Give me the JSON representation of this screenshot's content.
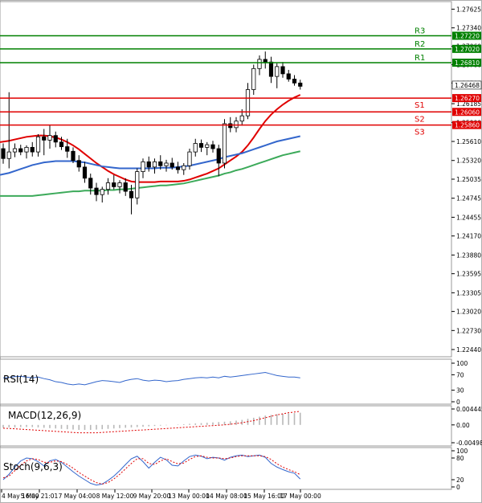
{
  "chart_data": {
    "type": "candlestick",
    "title": "",
    "x_labels": [
      "4 May 16:00",
      "5 May 21:01",
      "7 May 04:00",
      "8 May 12:00",
      "9 May 20:00",
      "13 May 00:00",
      "14 May 08:00",
      "15 May 16:00",
      "17 May 00:00"
    ],
    "price_axis": {
      "ylim": [
        1.2233,
        1.2774
      ],
      "ticks": [
        "1.27625",
        "1.27340",
        "1.27060",
        "1.26780",
        "1.26500",
        "1.26185",
        "1.25900",
        "1.25610",
        "1.25320",
        "1.25035",
        "1.24745",
        "1.24455",
        "1.24170",
        "1.23880",
        "1.23595",
        "1.23305",
        "1.23020",
        "1.22730",
        "1.22440"
      ]
    },
    "current_price": "1.26468",
    "levels": [
      {
        "name": "R3",
        "value": 1.2722,
        "label": "1.27220",
        "color": "#008000"
      },
      {
        "name": "R2",
        "value": 1.2702,
        "label": "1.27020",
        "color": "#008000"
      },
      {
        "name": "R1",
        "value": 1.2681,
        "label": "1.26810",
        "color": "#008000"
      },
      {
        "name": "S1",
        "value": 1.2627,
        "label": "1.26270",
        "color": "#e00000"
      },
      {
        "name": "S2",
        "value": 1.2606,
        "label": "1.26060",
        "color": "#e00000"
      },
      {
        "name": "S3",
        "value": 1.2586,
        "label": "1.25860",
        "color": "#e00000"
      }
    ],
    "candles": [
      {
        "o": 1.255,
        "h": 1.2558,
        "l": 1.2527,
        "c": 1.2535
      },
      {
        "o": 1.2535,
        "h": 1.2636,
        "l": 1.252,
        "c": 1.2545
      },
      {
        "o": 1.2545,
        "h": 1.2558,
        "l": 1.2537,
        "c": 1.255
      },
      {
        "o": 1.255,
        "h": 1.2556,
        "l": 1.254,
        "c": 1.2545
      },
      {
        "o": 1.2545,
        "h": 1.2555,
        "l": 1.2535,
        "c": 1.2552
      },
      {
        "o": 1.2552,
        "h": 1.256,
        "l": 1.2538,
        "c": 1.2545
      },
      {
        "o": 1.2545,
        "h": 1.2572,
        "l": 1.2538,
        "c": 1.2568
      },
      {
        "o": 1.2568,
        "h": 1.258,
        "l": 1.254,
        "c": 1.2563
      },
      {
        "o": 1.2563,
        "h": 1.2586,
        "l": 1.255,
        "c": 1.257
      },
      {
        "o": 1.257,
        "h": 1.2576,
        "l": 1.2552,
        "c": 1.256
      },
      {
        "o": 1.256,
        "h": 1.2568,
        "l": 1.2548,
        "c": 1.2553
      },
      {
        "o": 1.2553,
        "h": 1.2565,
        "l": 1.2536,
        "c": 1.2546
      },
      {
        "o": 1.2546,
        "h": 1.2552,
        "l": 1.2528,
        "c": 1.2532
      },
      {
        "o": 1.2532,
        "h": 1.254,
        "l": 1.2515,
        "c": 1.2522
      },
      {
        "o": 1.2522,
        "h": 1.253,
        "l": 1.2498,
        "c": 1.2505
      },
      {
        "o": 1.2505,
        "h": 1.2512,
        "l": 1.248,
        "c": 1.249
      },
      {
        "o": 1.249,
        "h": 1.2498,
        "l": 1.247,
        "c": 1.248
      },
      {
        "o": 1.248,
        "h": 1.2492,
        "l": 1.2468,
        "c": 1.2488
      },
      {
        "o": 1.2488,
        "h": 1.2505,
        "l": 1.248,
        "c": 1.2498
      },
      {
        "o": 1.2498,
        "h": 1.251,
        "l": 1.2488,
        "c": 1.2492
      },
      {
        "o": 1.2492,
        "h": 1.2502,
        "l": 1.2482,
        "c": 1.2498
      },
      {
        "o": 1.2498,
        "h": 1.2505,
        "l": 1.2478,
        "c": 1.2485
      },
      {
        "o": 1.2485,
        "h": 1.2495,
        "l": 1.245,
        "c": 1.2475
      },
      {
        "o": 1.2475,
        "h": 1.252,
        "l": 1.2465,
        "c": 1.2515
      },
      {
        "o": 1.2515,
        "h": 1.2535,
        "l": 1.2505,
        "c": 1.253
      },
      {
        "o": 1.253,
        "h": 1.2538,
        "l": 1.2515,
        "c": 1.2522
      },
      {
        "o": 1.2522,
        "h": 1.2535,
        "l": 1.2512,
        "c": 1.253
      },
      {
        "o": 1.253,
        "h": 1.254,
        "l": 1.2518,
        "c": 1.2524
      },
      {
        "o": 1.2524,
        "h": 1.2533,
        "l": 1.2515,
        "c": 1.2528
      },
      {
        "o": 1.2528,
        "h": 1.2536,
        "l": 1.2518,
        "c": 1.2522
      },
      {
        "o": 1.2522,
        "h": 1.253,
        "l": 1.2512,
        "c": 1.2518
      },
      {
        "o": 1.2518,
        "h": 1.2528,
        "l": 1.251,
        "c": 1.2524
      },
      {
        "o": 1.2524,
        "h": 1.255,
        "l": 1.2518,
        "c": 1.2545
      },
      {
        "o": 1.2545,
        "h": 1.2565,
        "l": 1.2538,
        "c": 1.2558
      },
      {
        "o": 1.2558,
        "h": 1.2564,
        "l": 1.2545,
        "c": 1.2552
      },
      {
        "o": 1.2552,
        "h": 1.256,
        "l": 1.254,
        "c": 1.2556
      },
      {
        "o": 1.2556,
        "h": 1.2562,
        "l": 1.2544,
        "c": 1.255
      },
      {
        "o": 1.255,
        "h": 1.2556,
        "l": 1.2508,
        "c": 1.2528
      },
      {
        "o": 1.2528,
        "h": 1.2595,
        "l": 1.252,
        "c": 1.2588
      },
      {
        "o": 1.2588,
        "h": 1.2598,
        "l": 1.2575,
        "c": 1.2582
      },
      {
        "o": 1.2582,
        "h": 1.2598,
        "l": 1.2575,
        "c": 1.2592
      },
      {
        "o": 1.2592,
        "h": 1.261,
        "l": 1.2585,
        "c": 1.26
      },
      {
        "o": 1.26,
        "h": 1.265,
        "l": 1.2595,
        "c": 1.264
      },
      {
        "o": 1.264,
        "h": 1.2678,
        "l": 1.2632,
        "c": 1.2672
      },
      {
        "o": 1.2672,
        "h": 1.2692,
        "l": 1.2662,
        "c": 1.2686
      },
      {
        "o": 1.2686,
        "h": 1.2698,
        "l": 1.2672,
        "c": 1.2682
      },
      {
        "o": 1.2682,
        "h": 1.269,
        "l": 1.265,
        "c": 1.266
      },
      {
        "o": 1.266,
        "h": 1.268,
        "l": 1.2642,
        "c": 1.2675
      },
      {
        "o": 1.2675,
        "h": 1.2682,
        "l": 1.2658,
        "c": 1.2664
      },
      {
        "o": 1.2664,
        "h": 1.267,
        "l": 1.2652,
        "c": 1.2656
      },
      {
        "o": 1.2656,
        "h": 1.2662,
        "l": 1.2646,
        "c": 1.265
      },
      {
        "o": 1.265,
        "h": 1.2655,
        "l": 1.264,
        "c": 1.2645
      }
    ],
    "moving_averages": [
      {
        "color": "#e00000",
        "values": [
          1.256,
          1.2562,
          1.2564,
          1.2566,
          1.2568,
          1.2569,
          1.257,
          1.257,
          1.2569,
          1.2567,
          1.2564,
          1.256,
          1.2555,
          1.2549,
          1.2542,
          1.2535,
          1.2528,
          1.2522,
          1.2516,
          1.2511,
          1.2507,
          1.2503,
          1.25,
          1.2499,
          1.2499,
          1.2499,
          1.2499,
          1.25,
          1.25,
          1.25,
          1.25,
          1.2501,
          1.2503,
          1.2506,
          1.2509,
          1.2512,
          1.2516,
          1.252,
          1.2526,
          1.2532,
          1.2538,
          1.2545,
          1.2555,
          1.2567,
          1.258,
          1.2592,
          1.2602,
          1.261,
          1.2617,
          1.2623,
          1.2628,
          1.2632
        ]
      },
      {
        "color": "#3366cc",
        "values": [
          1.251,
          1.2513,
          1.2516,
          1.2519,
          1.2522,
          1.2525,
          1.2527,
          1.2529,
          1.253,
          1.2531,
          1.2531,
          1.2531,
          1.2531,
          1.253,
          1.2529,
          1.2527,
          1.2525,
          1.2523,
          1.2522,
          1.2521,
          1.252,
          1.252,
          1.252,
          1.252,
          1.252,
          1.252,
          1.252,
          1.2521,
          1.2521,
          1.2521,
          1.2522,
          1.2523,
          1.2524,
          1.2526,
          1.2528,
          1.253,
          1.2532,
          1.2534,
          1.2537,
          1.2539,
          1.2541,
          1.2543,
          1.2546,
          1.2549,
          1.2552,
          1.2555,
          1.2558,
          1.2561,
          1.2563,
          1.2565,
          1.2567,
          1.2569
        ]
      },
      {
        "color": "#3caa5a",
        "values": [
          1.2478,
          1.2478,
          1.2478,
          1.2478,
          1.2478,
          1.2478,
          1.2479,
          1.248,
          1.2481,
          1.2482,
          1.2483,
          1.2484,
          1.2485,
          1.2485,
          1.2486,
          1.2486,
          1.2486,
          1.2486,
          1.2487,
          1.2487,
          1.2488,
          1.2488,
          1.2489,
          1.249,
          1.2491,
          1.2492,
          1.2493,
          1.2494,
          1.2494,
          1.2495,
          1.2496,
          1.2497,
          1.2499,
          1.2501,
          1.2503,
          1.2505,
          1.2507,
          1.2509,
          1.2512,
          1.2514,
          1.2517,
          1.2519,
          1.2522,
          1.2525,
          1.2528,
          1.2531,
          1.2534,
          1.2537,
          1.254,
          1.2542,
          1.2544,
          1.2546
        ]
      }
    ],
    "rsi": {
      "label": "RSI(14)",
      "levels": [
        "100",
        "70",
        "30",
        "0"
      ],
      "color": "#3366cc",
      "values": [
        62,
        63,
        65,
        66,
        64,
        62,
        64,
        60,
        57,
        52,
        50,
        46,
        44,
        46,
        44,
        48,
        52,
        55,
        54,
        52,
        50,
        55,
        58,
        60,
        56,
        54,
        56,
        55,
        52,
        54,
        55,
        58,
        60,
        62,
        63,
        62,
        64,
        62,
        66,
        64,
        66,
        68,
        70,
        72,
        74,
        76,
        72,
        68,
        66,
        64,
        64,
        62
      ]
    },
    "macd": {
      "label": "MACD(12,26,9)",
      "ticks": [
        "0.004445",
        "0.00",
        "-0.00498"
      ],
      "range": [
        -0.00498,
        0.004445
      ],
      "signal_color": "#e00000",
      "histogram": [
        -0.0008,
        -0.0007,
        -0.0007,
        -0.0006,
        -0.0006,
        -0.0006,
        -0.0007,
        -0.0008,
        -0.0009,
        -0.001,
        -0.0011,
        -0.0012,
        -0.0013,
        -0.0014,
        -0.0014,
        -0.0014,
        -0.0013,
        -0.0012,
        -0.0011,
        -0.001,
        -0.0009,
        -0.0008,
        -0.0007,
        -0.0006,
        -0.0005,
        -0.0004,
        -0.0003,
        -0.0002,
        -0.0001,
        0.0,
        0.0001,
        0.0002,
        0.0003,
        0.0004,
        0.0005,
        0.0006,
        0.0007,
        0.0008,
        0.0009,
        0.001,
        0.0012,
        0.0014,
        0.0017,
        0.002,
        0.0023,
        0.0026,
        0.0028,
        0.003,
        0.0031,
        0.0032,
        0.0033,
        0.0034
      ],
      "signal": [
        -0.0009,
        -0.001,
        -0.0011,
        -0.0012,
        -0.0013,
        -0.0014,
        -0.0015,
        -0.0016,
        -0.0017,
        -0.0018,
        -0.0019,
        -0.002,
        -0.0021,
        -0.0022,
        -0.0022,
        -0.0022,
        -0.0022,
        -0.0021,
        -0.002,
        -0.0019,
        -0.0018,
        -0.0017,
        -0.0016,
        -0.0015,
        -0.0014,
        -0.0013,
        -0.0012,
        -0.0011,
        -0.001,
        -0.0009,
        -0.0008,
        -0.0007,
        -0.0006,
        -0.0005,
        -0.0004,
        -0.0003,
        -0.0002,
        -0.0001,
        0.0,
        0.0002,
        0.0004,
        0.0006,
        0.0009,
        0.0012,
        0.0016,
        0.002,
        0.0024,
        0.0028,
        0.0031,
        0.0034,
        0.0036,
        0.0038
      ]
    },
    "stoch": {
      "label": "Stoch(9,6,3)",
      "levels": [
        "100",
        "80",
        "20",
        "0"
      ],
      "main_color": "#3366cc",
      "signal_color": "#e00000",
      "k": [
        20,
        35,
        55,
        72,
        80,
        78,
        70,
        58,
        72,
        76,
        68,
        55,
        42,
        30,
        20,
        10,
        5,
        8,
        18,
        30,
        45,
        62,
        78,
        85,
        70,
        52,
        68,
        82,
        75,
        60,
        58,
        72,
        84,
        88,
        85,
        78,
        82,
        80,
        74,
        82,
        86,
        88,
        84,
        86,
        88,
        82,
        65,
        55,
        48,
        42,
        38,
        22
      ],
      "d": [
        25,
        30,
        45,
        60,
        72,
        78,
        76,
        68,
        68,
        72,
        70,
        62,
        52,
        40,
        30,
        20,
        12,
        8,
        12,
        22,
        35,
        50,
        65,
        78,
        78,
        65,
        62,
        72,
        78,
        70,
        64,
        66,
        76,
        84,
        86,
        82,
        80,
        80,
        78,
        80,
        84,
        86,
        86,
        86,
        86,
        84,
        76,
        64,
        55,
        48,
        42,
        34
      ]
    }
  }
}
